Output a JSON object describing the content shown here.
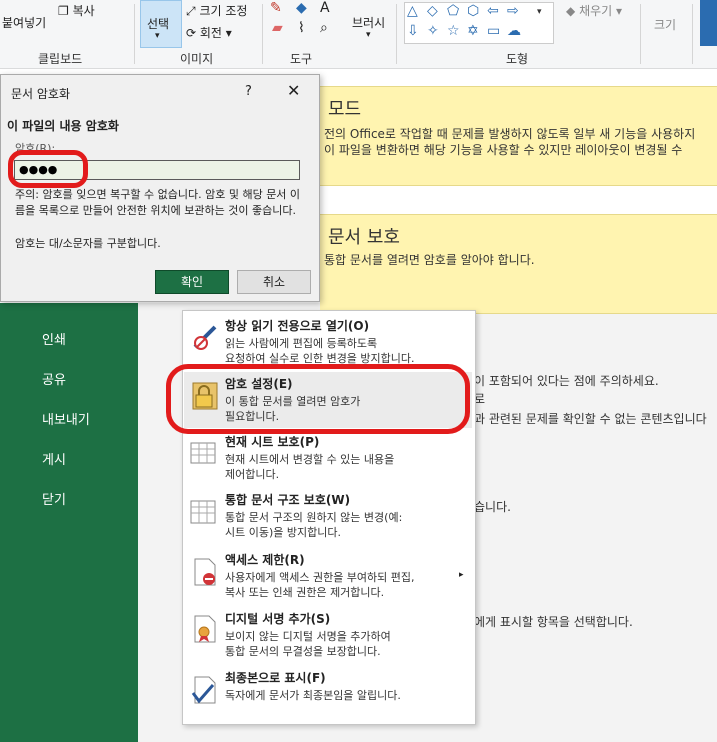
{
  "ribbon": {
    "paste": "붙여넣기",
    "copy": "복사",
    "select": "선택",
    "resize": "크기 조정",
    "rotate": "회전",
    "brushes": "브러시",
    "fill": "채우기",
    "size": "크기",
    "groups": {
      "clipboard": "클립보드",
      "image": "이미지",
      "tools": "도구",
      "shapes": "도형"
    }
  },
  "dialog": {
    "title": "문서 암호화",
    "help": "?",
    "close": "✕",
    "heading": "이 파일의 내용 암호화",
    "password_label": "암호(R):",
    "password_value": "●●●●",
    "warning": "주의: 암호를 잊으면 복구할 수 없습니다. 암호 및 해당 문서 이름을 목록으로 만들어 안전한 위치에 보관하는 것이 좋습니다.",
    "case_note": "암호는 대/소문자를 구분합니다.",
    "ok": "확인",
    "cancel": "취소"
  },
  "background": {
    "mode_title": "모드",
    "mode_line1": "전의 Office로 작업할 때 문제를 발생하지 않도록 일부 새 기능을 사용하지",
    "mode_line2": "이 파일을 변환하면 해당 기능을 사용할 수 있지만 레이아웃이 변경될 수",
    "protect_title": "문서 보호",
    "protect_text": "통합 문서를 열려면 암호를 알아야 합니다.",
    "line_a": "이 포함되어 있다는 점에 주의하세요.",
    "line_b": "로",
    "line_c": "과 관련된 문제를 확인할 수 없는 콘텐츠입니다",
    "line_d": "습니다.",
    "line_e": "에게 표시할 항목을 선택합니다."
  },
  "sidebar": {
    "items": [
      "인쇄",
      "공유",
      "내보내기",
      "게시",
      "닫기"
    ]
  },
  "menu": {
    "items": [
      {
        "title": "항상 읽기 전용으로 열기(O)",
        "desc1": "읽는 사람에게 편집에 등록하도록",
        "desc2": "요청하여 실수로 인한 변경을 방지합니다."
      },
      {
        "title": "암호 설정(E)",
        "desc1": "이 통합 문서를 열려면 암호가",
        "desc2": "필요합니다."
      },
      {
        "title": "현재 시트 보호(P)",
        "desc1": "현재 시트에서 변경할 수 있는 내용을",
        "desc2": "제어합니다."
      },
      {
        "title": "통합 문서 구조 보호(W)",
        "desc1": "통합 문서 구조의 원하지 않는 변경(예:",
        "desc2": "시트 이동)을 방지합니다."
      },
      {
        "title": "액세스 제한(R)",
        "desc1": "사용자에게 액세스 권한을 부여하되 편집,",
        "desc2": "복사 또는 인쇄 권한은 제거합니다."
      },
      {
        "title": "디지털 서명 추가(S)",
        "desc1": "보이지 않는 디지털 서명을 추가하여",
        "desc2": "통합 문서의 무결성을 보장합니다."
      },
      {
        "title": "최종본으로 표시(F)",
        "desc1": "독자에게 문서가 최종본임을 알립니다.",
        "desc2": ""
      }
    ],
    "submenu_arrow": "▸"
  },
  "colors": {
    "excel_green": "#1d7044",
    "highlight_red": "#e21b1b",
    "banner_yellow": "#fff4b0"
  }
}
